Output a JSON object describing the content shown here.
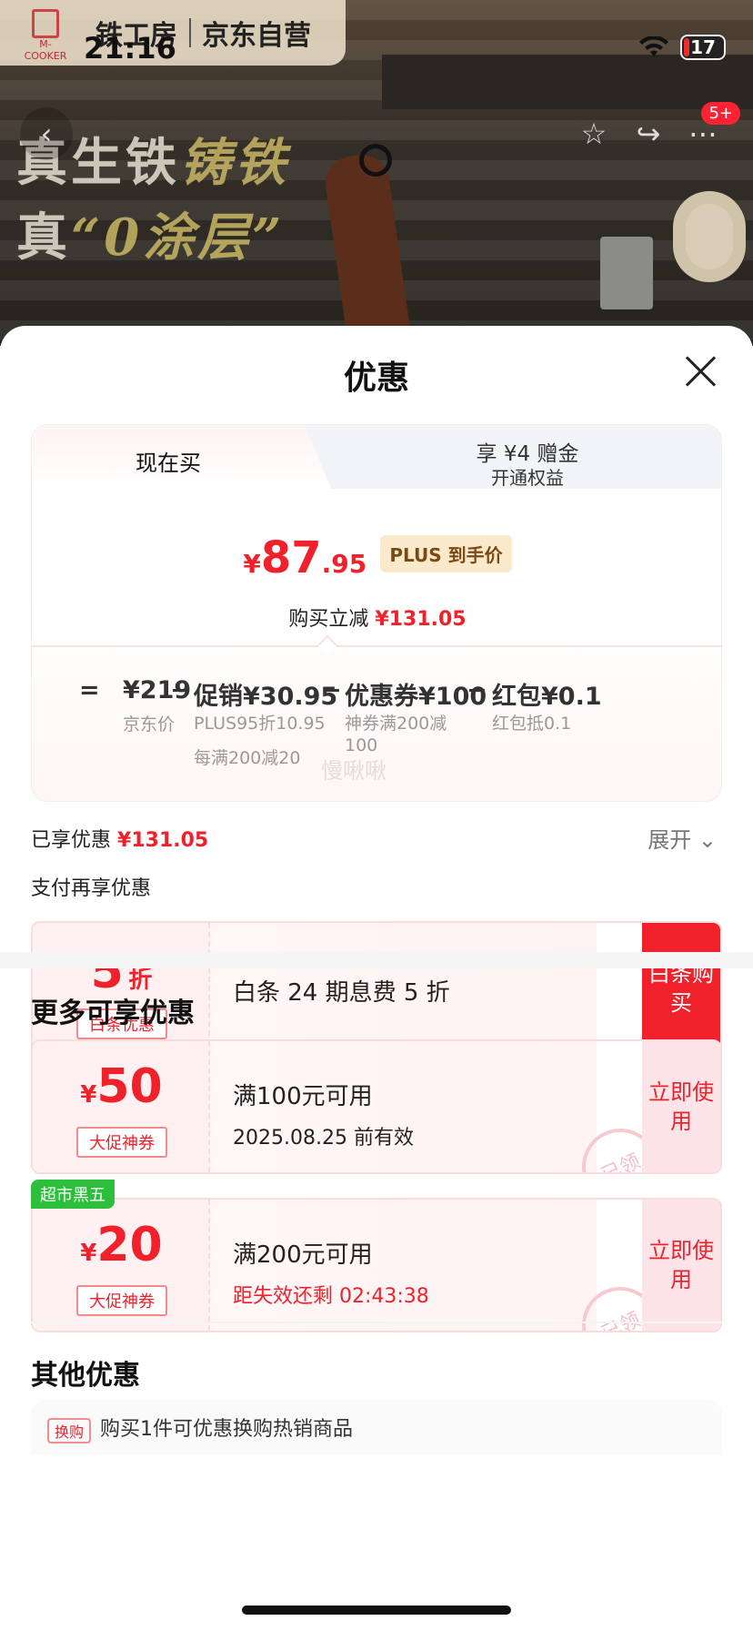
{
  "status": {
    "time": "21:16",
    "battery": "17"
  },
  "brand": {
    "logo_text": "M-COOKER",
    "name": "铁工房",
    "store": "京东自营"
  },
  "promo": {
    "line1a": "真生铁",
    "line1b": "铸铁",
    "line2a": "真",
    "line2b": "“0涂层”"
  },
  "header_badge": "5+",
  "sheet": {
    "title": "优惠",
    "tab_buy_now": "现在买",
    "tab_bonus_line1": "享 ¥4 赠金",
    "tab_bonus_line2": "开通权益",
    "price_currency": "¥",
    "price_int": "87",
    "price_dec": ".95",
    "price_tag": "PLUS 到手价",
    "instant_cut_label": "购买立减",
    "instant_cut_value": "¥131.05",
    "calc": {
      "equals": "=",
      "jd_price": "¥219",
      "jd_price_label": "京东价",
      "minus": "−",
      "promo": "促销¥30.95",
      "promo_sub1": "PLUS95折10.95",
      "promo_sub2": "每满200减20",
      "coupon": "优惠券¥100",
      "coupon_sub1": "神券满200减",
      "coupon_sub2": "100",
      "redpack": "红包¥0.1",
      "redpack_sub": "红包抵0.1"
    },
    "watermark": "慢啾啾",
    "enjoyed_label": "已享优惠",
    "enjoyed_value": "¥131.05",
    "expand": "展开",
    "pay_more": "支付再享优惠",
    "baitiao": {
      "value": "5",
      "unit": "折",
      "tag": "白条优惠",
      "text": "白条 24 期息费 5 折",
      "action": "白条购买"
    },
    "more_title": "更多可享优惠",
    "coupons": [
      {
        "currency": "¥",
        "value": "50",
        "tag": "大促神券",
        "line1": "满100元可用",
        "line2": "2025.08.25 前有效",
        "action": "立即使用",
        "stamp": "已领"
      },
      {
        "corner": "超市黑五",
        "currency": "¥",
        "value": "20",
        "tag": "大促神券",
        "line1": "满200元可用",
        "line2": "距失效还剩 02:43:38",
        "action": "立即使用",
        "stamp": "已领"
      }
    ],
    "other_title": "其他优惠",
    "other_row": {
      "label": "换购",
      "text": "购买1件可优惠换购热销商品"
    }
  }
}
